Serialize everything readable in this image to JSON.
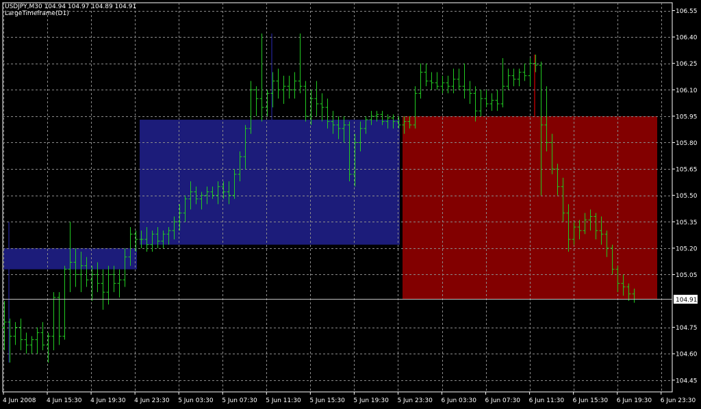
{
  "header": {
    "symbol_line": "USDJPY,M30  104.94 104.97 104.89 104.91",
    "indicator_label": "LargeTimeframe(D1)"
  },
  "colors": {
    "background": "#000000",
    "grid": "#8c8c8c",
    "bars": "#22cc22",
    "bull_box": "#1c1c7a",
    "bear_box": "#820000",
    "axis_text": "#ffffff",
    "price_line": "#c0c0c0"
  },
  "chart_data": {
    "type": "ohlc",
    "symbol": "USDJPY",
    "timeframe": "M30",
    "last": {
      "open": 104.94,
      "high": 104.97,
      "low": 104.89,
      "close": 104.91
    },
    "current_price_label": "104.91",
    "ylim": [
      104.38,
      106.64
    ],
    "y_ticks": [
      "106.55",
      "106.40",
      "106.25",
      "106.10",
      "105.95",
      "105.80",
      "105.65",
      "105.50",
      "105.35",
      "105.20",
      "105.05",
      "104.75",
      "104.60",
      "104.45"
    ],
    "x_ticks": [
      "4 Jun 2008",
      "4 Jun 15:30",
      "4 Jun 19:30",
      "4 Jun 23:30",
      "5 Jun 03:30",
      "5 Jun 07:30",
      "5 Jun 11:30",
      "5 Jun 15:30",
      "5 Jun 19:30",
      "5 Jun 23:30",
      "6 Jun 03:30",
      "6 Jun 07:30",
      "6 Jun 11:30",
      "6 Jun 15:30",
      "6 Jun 19:30",
      "6 Jun 23:30"
    ],
    "grid": true,
    "daily_boxes": [
      {
        "label": "4 Jun 2008",
        "open": 105.2,
        "close": 105.08,
        "high": 105.35,
        "low": 104.55,
        "color": "bull"
      },
      {
        "label": "5 Jun",
        "open": 105.22,
        "close": 105.93,
        "high": 106.42,
        "low": 105.1,
        "color": "bull"
      },
      {
        "label": "6 Jun",
        "open": 105.95,
        "close": 104.91,
        "high": 106.3,
        "low": 104.89,
        "color": "bear"
      }
    ],
    "series": [
      {
        "values": [
          [
            104.75,
            104.9,
            104.62,
            104.78
          ],
          [
            104.78,
            104.8,
            104.55,
            104.7
          ],
          [
            104.7,
            104.78,
            104.65,
            104.75
          ],
          [
            104.75,
            104.8,
            104.62,
            104.68
          ],
          [
            104.68,
            104.72,
            104.6,
            104.65
          ],
          [
            104.65,
            104.7,
            104.6,
            104.68
          ],
          [
            104.68,
            104.75,
            104.6,
            104.72
          ],
          [
            104.72,
            104.78,
            104.62,
            104.65
          ],
          [
            104.65,
            104.72,
            104.55,
            104.7
          ],
          [
            104.7,
            104.95,
            104.62,
            104.92
          ],
          [
            104.92,
            104.95,
            104.65,
            104.7
          ],
          [
            104.7,
            105.1,
            104.68,
            105.08
          ],
          [
            105.08,
            105.35,
            104.95,
            105.12
          ],
          [
            105.12,
            105.2,
            104.98,
            105.05
          ],
          [
            105.05,
            105.18,
            104.95,
            105.1
          ],
          [
            105.1,
            105.15,
            104.98,
            105.02
          ],
          [
            105.02,
            105.1,
            104.9,
            105.05
          ],
          [
            105.05,
            105.12,
            104.95,
            105.0
          ],
          [
            105.0,
            105.08,
            104.85,
            104.95
          ],
          [
            104.95,
            105.1,
            104.88,
            105.05
          ],
          [
            105.05,
            105.1,
            104.95,
            105.0
          ],
          [
            105.0,
            105.08,
            104.92,
            105.02
          ],
          [
            105.02,
            105.2,
            104.98,
            105.15
          ],
          [
            105.15,
            105.32,
            105.1,
            105.28
          ],
          [
            105.28,
            105.3,
            105.18,
            105.25
          ],
          [
            105.25,
            105.3,
            105.2,
            105.25
          ],
          [
            105.25,
            105.32,
            105.18,
            105.22
          ],
          [
            105.22,
            105.3,
            105.18,
            105.28
          ],
          [
            105.28,
            105.32,
            105.2,
            105.24
          ],
          [
            105.24,
            105.3,
            105.2,
            105.28
          ],
          [
            105.28,
            105.32,
            105.22,
            105.3
          ],
          [
            105.3,
            105.38,
            105.25,
            105.35
          ],
          [
            105.35,
            105.45,
            105.3,
            105.4
          ],
          [
            105.4,
            105.5,
            105.35,
            105.48
          ],
          [
            105.48,
            105.58,
            105.42,
            105.52
          ],
          [
            105.52,
            105.55,
            105.45,
            105.48
          ],
          [
            105.48,
            105.52,
            105.42,
            105.5
          ],
          [
            105.5,
            105.55,
            105.45,
            105.52
          ],
          [
            105.52,
            105.55,
            105.48,
            105.5
          ],
          [
            105.5,
            105.58,
            105.45,
            105.55
          ],
          [
            105.55,
            105.58,
            105.48,
            105.52
          ],
          [
            105.52,
            105.58,
            105.45,
            105.5
          ],
          [
            105.5,
            105.65,
            105.48,
            105.62
          ],
          [
            105.62,
            105.75,
            105.58,
            105.72
          ],
          [
            105.72,
            105.9,
            105.65,
            105.88
          ],
          [
            105.88,
            106.15,
            105.85,
            106.1
          ],
          [
            106.1,
            106.12,
            105.95,
            106.05
          ],
          [
            106.05,
            106.42,
            105.92,
            106.0
          ],
          [
            106.0,
            106.1,
            105.95,
            106.08
          ],
          [
            106.08,
            106.2,
            106.0,
            106.15
          ],
          [
            106.15,
            106.22,
            106.05,
            106.1
          ],
          [
            106.1,
            106.18,
            106.02,
            106.12
          ],
          [
            106.12,
            106.18,
            106.05,
            106.1
          ],
          [
            106.1,
            106.2,
            106.05,
            106.15
          ],
          [
            106.15,
            106.42,
            106.08,
            106.12
          ],
          [
            106.12,
            106.15,
            105.92,
            105.95
          ],
          [
            105.95,
            106.1,
            105.9,
            106.05
          ],
          [
            106.05,
            106.15,
            105.95,
            106.02
          ],
          [
            106.02,
            106.08,
            105.92,
            106.0
          ],
          [
            106.0,
            106.05,
            105.88,
            105.92
          ],
          [
            105.92,
            105.98,
            105.85,
            105.9
          ],
          [
            105.9,
            105.95,
            105.82,
            105.88
          ],
          [
            105.88,
            105.95,
            105.8,
            105.9
          ],
          [
            105.9,
            105.92,
            105.58,
            105.62
          ],
          [
            105.62,
            105.85,
            105.55,
            105.8
          ],
          [
            105.8,
            105.92,
            105.75,
            105.88
          ],
          [
            105.88,
            105.95,
            105.85,
            105.93
          ],
          [
            105.93,
            105.98,
            105.9,
            105.95
          ],
          [
            105.95,
            105.98,
            105.92,
            105.96
          ],
          [
            105.96,
            105.98,
            105.9,
            105.92
          ],
          [
            105.92,
            105.96,
            105.88,
            105.94
          ],
          [
            105.94,
            105.96,
            105.88,
            105.92
          ],
          [
            105.92,
            105.95,
            105.88,
            105.9
          ],
          [
            105.9,
            105.95,
            105.85,
            105.92
          ],
          [
            105.92,
            105.95,
            105.88,
            105.9
          ],
          [
            105.9,
            106.12,
            105.88,
            106.08
          ],
          [
            106.08,
            106.25,
            106.05,
            106.2
          ],
          [
            106.2,
            106.25,
            106.12,
            106.15
          ],
          [
            106.15,
            106.2,
            106.1,
            106.14
          ],
          [
            106.14,
            106.2,
            106.1,
            106.12
          ],
          [
            106.12,
            106.18,
            106.08,
            106.14
          ],
          [
            106.14,
            106.18,
            106.08,
            106.12
          ],
          [
            106.12,
            106.22,
            106.08,
            106.16
          ],
          [
            106.16,
            106.22,
            106.1,
            106.12
          ],
          [
            106.12,
            106.25,
            106.05,
            106.1
          ],
          [
            106.1,
            106.15,
            106.02,
            106.08
          ],
          [
            106.08,
            106.12,
            105.92,
            105.98
          ],
          [
            105.98,
            106.1,
            105.95,
            106.05
          ],
          [
            106.05,
            106.1,
            106.0,
            106.02
          ],
          [
            106.02,
            106.08,
            105.98,
            106.04
          ],
          [
            106.04,
            106.1,
            105.98,
            106.02
          ],
          [
            106.02,
            106.28,
            106.0,
            106.12
          ],
          [
            106.12,
            106.22,
            106.1,
            106.18
          ],
          [
            106.18,
            106.22,
            106.12,
            106.16
          ],
          [
            106.16,
            106.22,
            106.12,
            106.2
          ],
          [
            106.2,
            106.25,
            106.15,
            106.18
          ],
          [
            106.18,
            106.28,
            106.12,
            106.25
          ],
          [
            106.25,
            106.3,
            106.2,
            106.24
          ],
          [
            106.24,
            106.26,
            105.5,
            105.9
          ],
          [
            105.9,
            106.12,
            105.75,
            105.8
          ],
          [
            105.8,
            105.85,
            105.62,
            105.65
          ],
          [
            105.65,
            105.68,
            105.5,
            105.55
          ],
          [
            105.55,
            105.6,
            105.35,
            105.4
          ],
          [
            105.4,
            105.45,
            105.18,
            105.25
          ],
          [
            105.25,
            105.35,
            105.22,
            105.32
          ],
          [
            105.32,
            105.36,
            105.25,
            105.3
          ],
          [
            105.3,
            105.4,
            105.28,
            105.36
          ],
          [
            105.36,
            105.42,
            105.3,
            105.38
          ],
          [
            105.38,
            105.4,
            105.25,
            105.3
          ],
          [
            105.3,
            105.38,
            105.22,
            105.28
          ],
          [
            105.28,
            105.3,
            105.15,
            105.2
          ],
          [
            105.2,
            105.22,
            105.05,
            105.08
          ],
          [
            105.08,
            105.1,
            104.95,
            105.0
          ],
          [
            105.0,
            105.05,
            104.93,
            104.98
          ],
          [
            104.98,
            105.0,
            104.9,
            104.94
          ],
          [
            104.94,
            104.97,
            104.89,
            104.91
          ]
        ]
      }
    ]
  }
}
